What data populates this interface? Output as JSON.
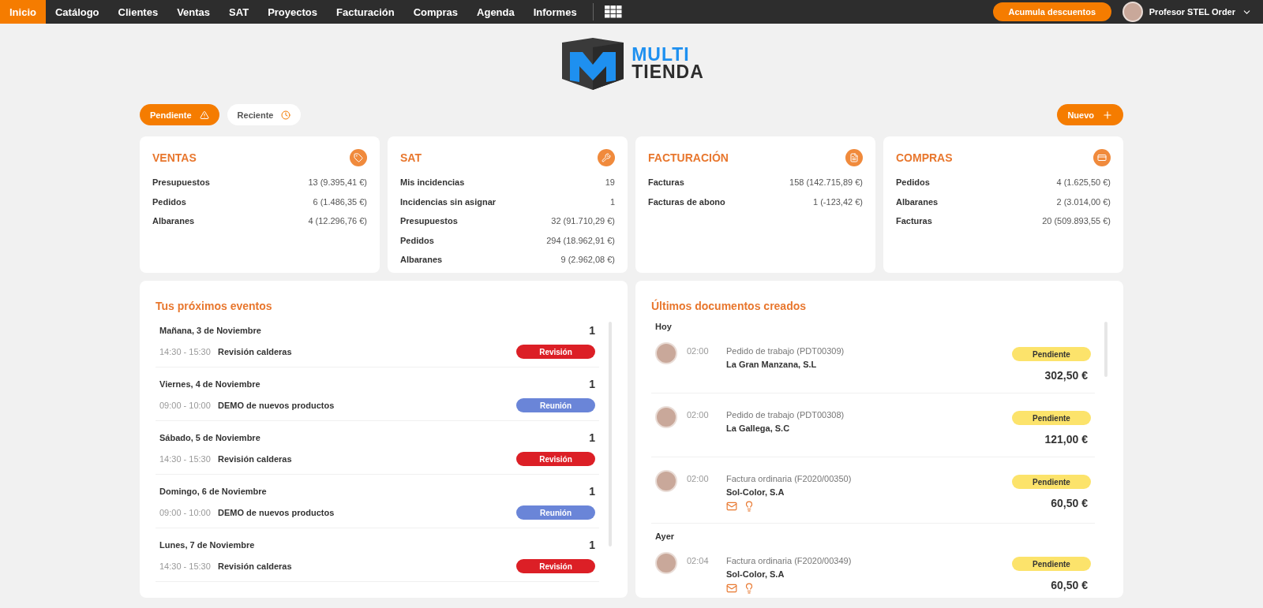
{
  "nav": {
    "items": [
      {
        "label": "Inicio",
        "selected": true
      },
      {
        "label": "Catálogo",
        "selected": false
      },
      {
        "label": "Clientes",
        "selected": false
      },
      {
        "label": "Ventas",
        "selected": false
      },
      {
        "label": "SAT",
        "selected": false
      },
      {
        "label": "Proyectos",
        "selected": false
      },
      {
        "label": "Facturación",
        "selected": false
      },
      {
        "label": "Compras",
        "selected": false
      },
      {
        "label": "Agenda",
        "selected": false
      },
      {
        "label": "Informes",
        "selected": false
      }
    ],
    "promo_button": "Acumula descuentos",
    "user": "Profesor STEL Order"
  },
  "logo": {
    "line_1": "MULTI",
    "line_2": "TIENDA"
  },
  "filters": [
    {
      "label": "Pendiente",
      "selected": true
    },
    {
      "label": "Reciente",
      "selected": false
    }
  ],
  "new_button": "Nuevo",
  "cards": [
    {
      "title": "VENTAS",
      "rows": [
        {
          "label": "Presupuestos",
          "value": "13 (9.395,41 €)"
        },
        {
          "label": "Pedidos",
          "value": "6 (1.486,35 €)"
        },
        {
          "label": "Albaranes",
          "value": "4 (12.296,76 €)"
        }
      ]
    },
    {
      "title": "SAT",
      "rows": [
        {
          "label": "Mis incidencias",
          "value": "19"
        },
        {
          "label": "Incidencias sin asignar",
          "value": "1"
        },
        {
          "label": "Presupuestos",
          "value": "32 (91.710,29 €)"
        },
        {
          "label": "Pedidos",
          "value": "294 (18.962,91 €)"
        },
        {
          "label": "Albaranes",
          "value": "9 (2.962,08 €)"
        }
      ]
    },
    {
      "title": "FACTURACIÓN",
      "rows": [
        {
          "label": "Facturas",
          "value": "158 (142.715,89 €)"
        },
        {
          "label": "Facturas de abono",
          "value": "1 (-123,42 €)"
        }
      ]
    },
    {
      "title": "COMPRAS",
      "rows": [
        {
          "label": "Pedidos",
          "value": "4 (1.625,50 €)"
        },
        {
          "label": "Albaranes",
          "value": "2 (3.014,00 €)"
        },
        {
          "label": "Facturas",
          "value": "20 (509.893,55 €)"
        }
      ]
    }
  ],
  "events": {
    "title": "Tus próximos eventos",
    "days": [
      {
        "date": "Mañana, 3 de Noviembre",
        "count": "1",
        "time": "14:30 - 15:30",
        "name": "Revisión calderas",
        "tag": "Revisión",
        "color": "#dc1f26"
      },
      {
        "date": "Viernes, 4 de Noviembre",
        "count": "1",
        "time": "09:00 - 10:00",
        "name": "DEMO de nuevos productos",
        "tag": "Reunión",
        "color": "#6a85d8"
      },
      {
        "date": "Sábado, 5 de Noviembre",
        "count": "1",
        "time": "14:30 - 15:30",
        "name": "Revisión calderas",
        "tag": "Revisión",
        "color": "#dc1f26"
      },
      {
        "date": "Domingo, 6 de Noviembre",
        "count": "1",
        "time": "09:00 - 10:00",
        "name": "DEMO de nuevos productos",
        "tag": "Reunión",
        "color": "#6a85d8"
      },
      {
        "date": "Lunes, 7 de Noviembre",
        "count": "1",
        "time": "14:30 - 15:30",
        "name": "Revisión calderas",
        "tag": "Revisión",
        "color": "#dc1f26"
      }
    ]
  },
  "documents": {
    "title": "Últimos documentos creados",
    "groups": [
      {
        "label": "Hoy",
        "items": [
          {
            "time": "02:00",
            "doc": "Pedido de trabajo (PDT00309)",
            "client": "La Gran Manzana, S.L",
            "status": "Pendiente",
            "amount": "302,50 €",
            "actions": false
          },
          {
            "time": "02:00",
            "doc": "Pedido de trabajo (PDT00308)",
            "client": "La Gallega, S.C",
            "status": "Pendiente",
            "amount": "121,00 €",
            "actions": false
          },
          {
            "time": "02:00",
            "doc": "Factura ordinaria (F2020/00350)",
            "client": "Sol-Color, S.A",
            "status": "Pendiente",
            "amount": "60,50 €",
            "actions": true
          }
        ]
      },
      {
        "label": "Ayer",
        "items": [
          {
            "time": "02:04",
            "doc": "Factura ordinaria (F2020/00349)",
            "client": "Sol-Color, S.A",
            "status": "Pendiente",
            "amount": "60,50 €",
            "actions": true
          }
        ]
      }
    ]
  }
}
